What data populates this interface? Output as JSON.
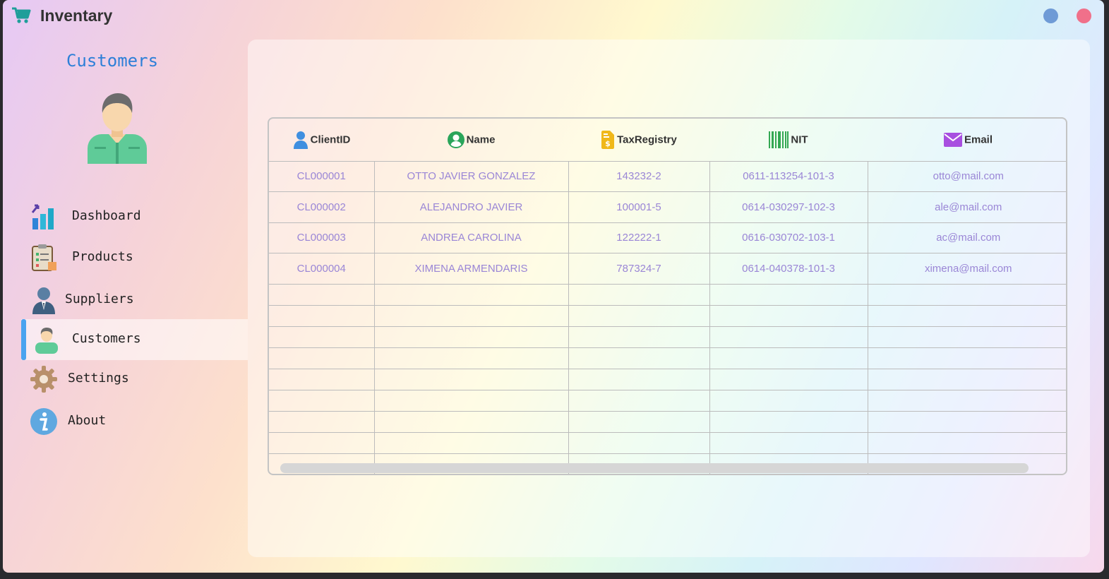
{
  "app": {
    "title": "Inventary",
    "icon": "shopping-cart-icon",
    "accent": "#1f9e9a"
  },
  "sidebar": {
    "section_title": "Customers",
    "avatar_icon": "customer-avatar-icon",
    "items": [
      {
        "id": "dashboard",
        "label": "Dashboard",
        "icon": "bar-chart-icon"
      },
      {
        "id": "products",
        "label": "Products",
        "icon": "clipboard-icon"
      },
      {
        "id": "suppliers",
        "label": "Suppliers",
        "icon": "businessman-icon"
      },
      {
        "id": "customers",
        "label": "Customers",
        "icon": "customer-icon",
        "active": true
      },
      {
        "id": "settings",
        "label": "Settings",
        "icon": "gear-icon"
      },
      {
        "id": "about",
        "label": "About",
        "icon": "info-icon"
      }
    ]
  },
  "table": {
    "columns": [
      {
        "label": "ClientID",
        "icon": "user-icon"
      },
      {
        "label": "Name",
        "icon": "account-circle-icon"
      },
      {
        "label": "TaxRegistry",
        "icon": "invoice-icon"
      },
      {
        "label": "NIT",
        "icon": "barcode-icon"
      },
      {
        "label": "Email",
        "icon": "envelope-icon"
      }
    ],
    "rows": [
      [
        "CL000001",
        "OTTO JAVIER GONZALEZ",
        "143232-2",
        "0611-113254-101-3",
        "otto@mail.com"
      ],
      [
        "CL000002",
        "ALEJANDRO JAVIER",
        "100001-5",
        "0614-030297-102-3",
        "ale@mail.com"
      ],
      [
        "CL000003",
        "ANDREA CAROLINA",
        "122222-1",
        "0616-030702-103-1",
        "ac@mail.com"
      ],
      [
        "CL000004",
        "XIMENA ARMENDARIS",
        "787324-7",
        "0614-040378-101-3",
        "ximena@mail.com"
      ]
    ]
  }
}
